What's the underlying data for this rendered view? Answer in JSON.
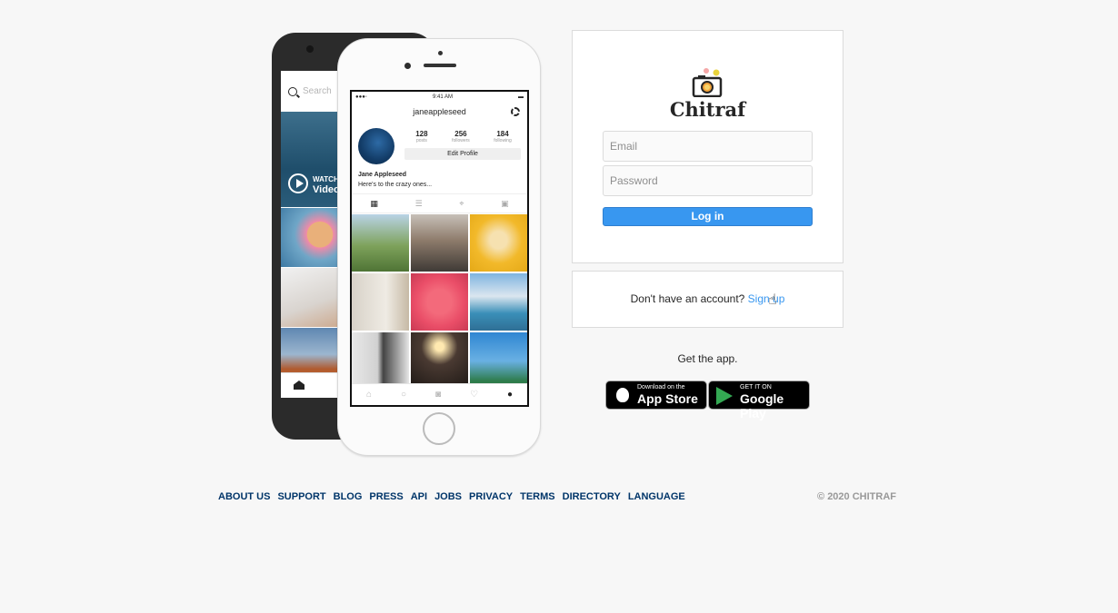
{
  "phone_back": {
    "search_placeholder": "Search",
    "video_label_top": "WATCH",
    "video_label_bottom": "Video"
  },
  "phone_front": {
    "status_time": "9:41 AM",
    "username": "janeappleseed",
    "stats": [
      {
        "value": "128",
        "label": "posts"
      },
      {
        "value": "256",
        "label": "followers"
      },
      {
        "value": "184",
        "label": "following"
      }
    ],
    "edit_profile": "Edit Profile",
    "bio_name": "Jane Appleseed",
    "bio_text": "Here's to the crazy ones..."
  },
  "login": {
    "brand": "Chitraf",
    "email_placeholder": "Email",
    "password_placeholder": "Password",
    "login_button": "Log in"
  },
  "signup": {
    "prompt": "Don't have an account?",
    "link": "Sign up"
  },
  "get_app": {
    "label": "Get the app.",
    "app_store_small": "Download on the",
    "app_store_big": "App Store",
    "google_small": "GET IT ON",
    "google_big": "Google Play"
  },
  "footer": {
    "links": [
      "ABOUT US",
      "SUPPORT",
      "BLOG",
      "PRESS",
      "API",
      "JOBS",
      "PRIVACY",
      "TERMS",
      "DIRECTORY",
      "LANGUAGE"
    ],
    "copyright": "© 2020 CHITRAF"
  },
  "colors": {
    "primary_blue": "#3897f0",
    "link_blue": "#003569",
    "background": "#f7f7f7"
  }
}
